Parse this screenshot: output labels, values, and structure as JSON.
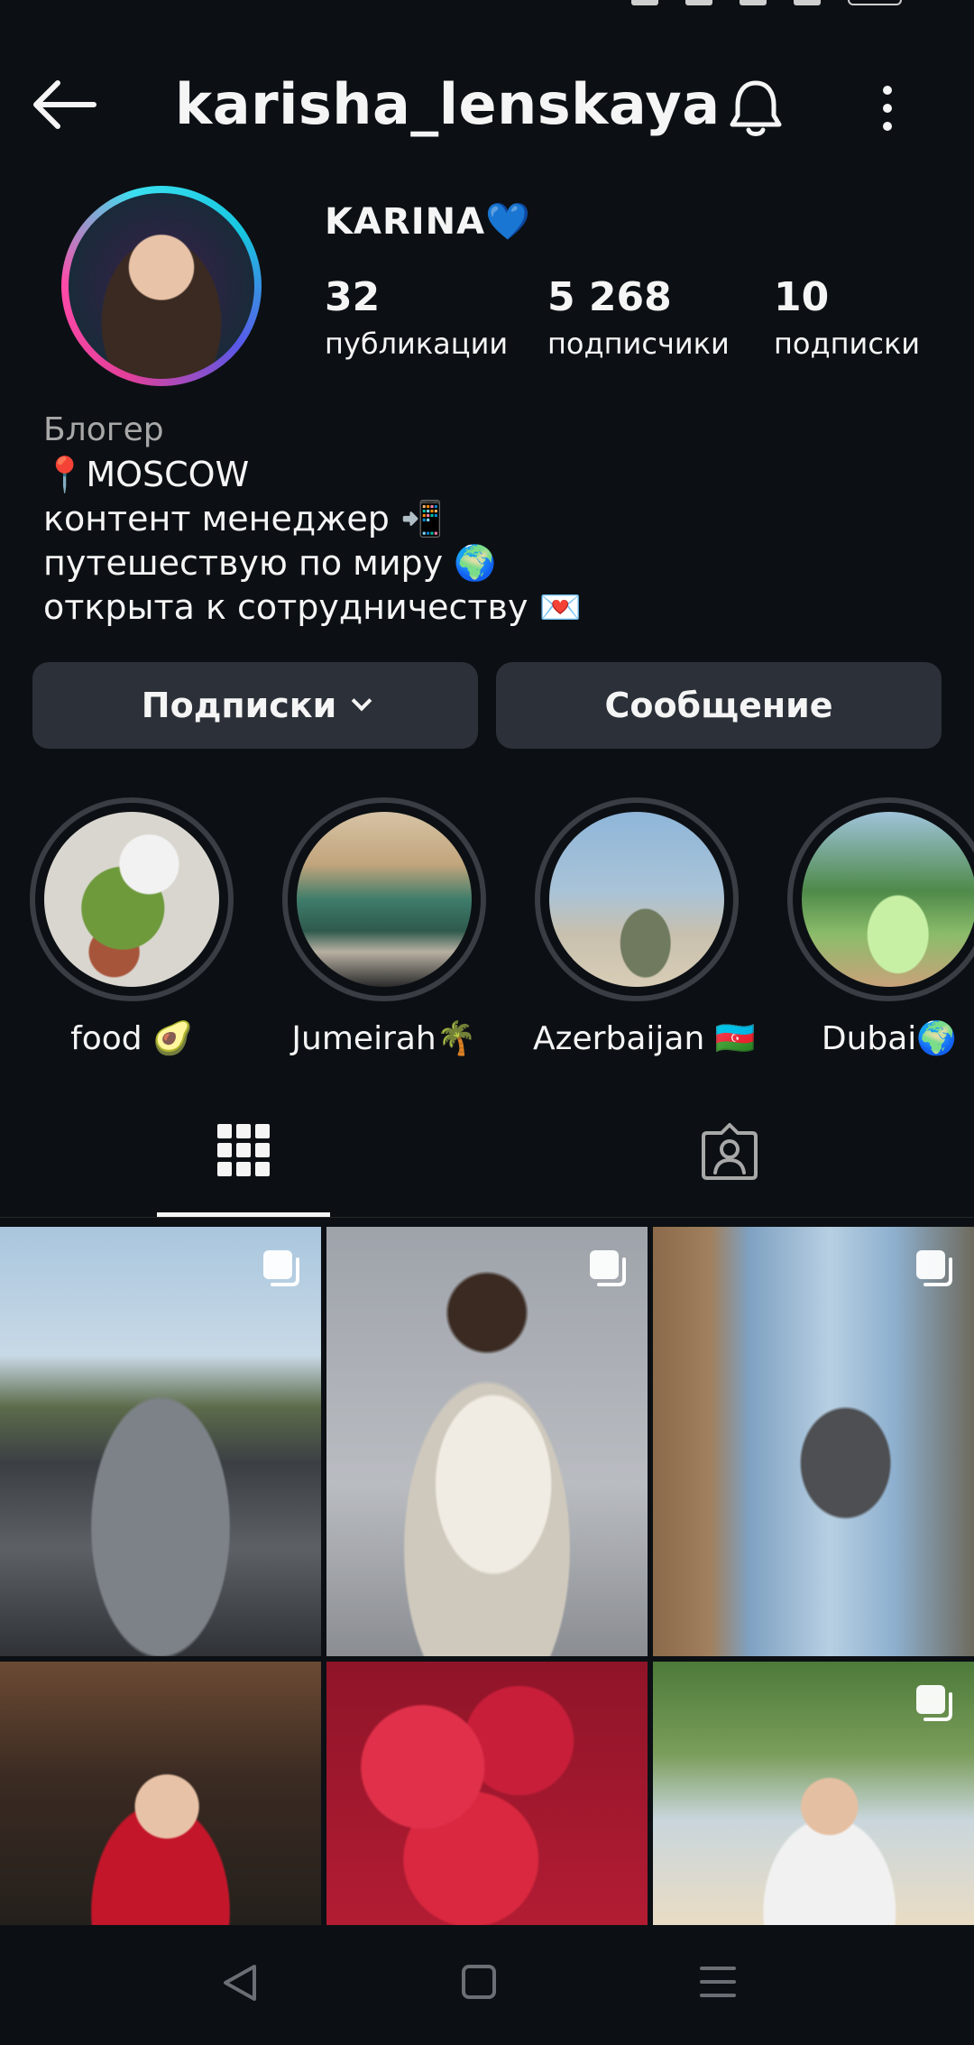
{
  "header": {
    "username": "karisha_lenskaya",
    "back_icon": "arrow-left-icon",
    "bell_icon": "bell-icon",
    "more_icon": "more-vertical-icon"
  },
  "profile": {
    "display_name": "KARINA💙",
    "stats": [
      {
        "value": "32",
        "label": "публикации"
      },
      {
        "value": "5 268",
        "label": "подписчики"
      },
      {
        "value": "10",
        "label": "подписки"
      }
    ],
    "category": "Блогер",
    "bio_lines": [
      "📍MOSCOW",
      "контент менеджер 📲",
      "путешествую по миру 🌍",
      "открыта к сотрудничеству 💌"
    ]
  },
  "actions": {
    "following_label": "Подписки",
    "message_label": "Сообщение"
  },
  "highlights": [
    {
      "label": "food 🥑"
    },
    {
      "label": "Jumeirah🌴"
    },
    {
      "label": "Azerbaijan 🇦🇿"
    },
    {
      "label": "Dubai🌍"
    }
  ],
  "tabs": {
    "active": "grid",
    "items": [
      "grid-icon",
      "tagged-icon"
    ]
  },
  "posts": [
    {
      "name": "post-supercar",
      "multi": true
    },
    {
      "name": "post-tulips",
      "multi": true
    },
    {
      "name": "post-baku-street",
      "multi": true
    },
    {
      "name": "post-restaurant",
      "multi": false
    },
    {
      "name": "post-red-balloons",
      "multi": false
    },
    {
      "name": "post-palm-beach",
      "multi": true
    }
  ],
  "colors": {
    "background": "#0c1014",
    "button": "#2c3038",
    "text": "#f5f5f5",
    "secondary_text": "#a8a8a8"
  }
}
